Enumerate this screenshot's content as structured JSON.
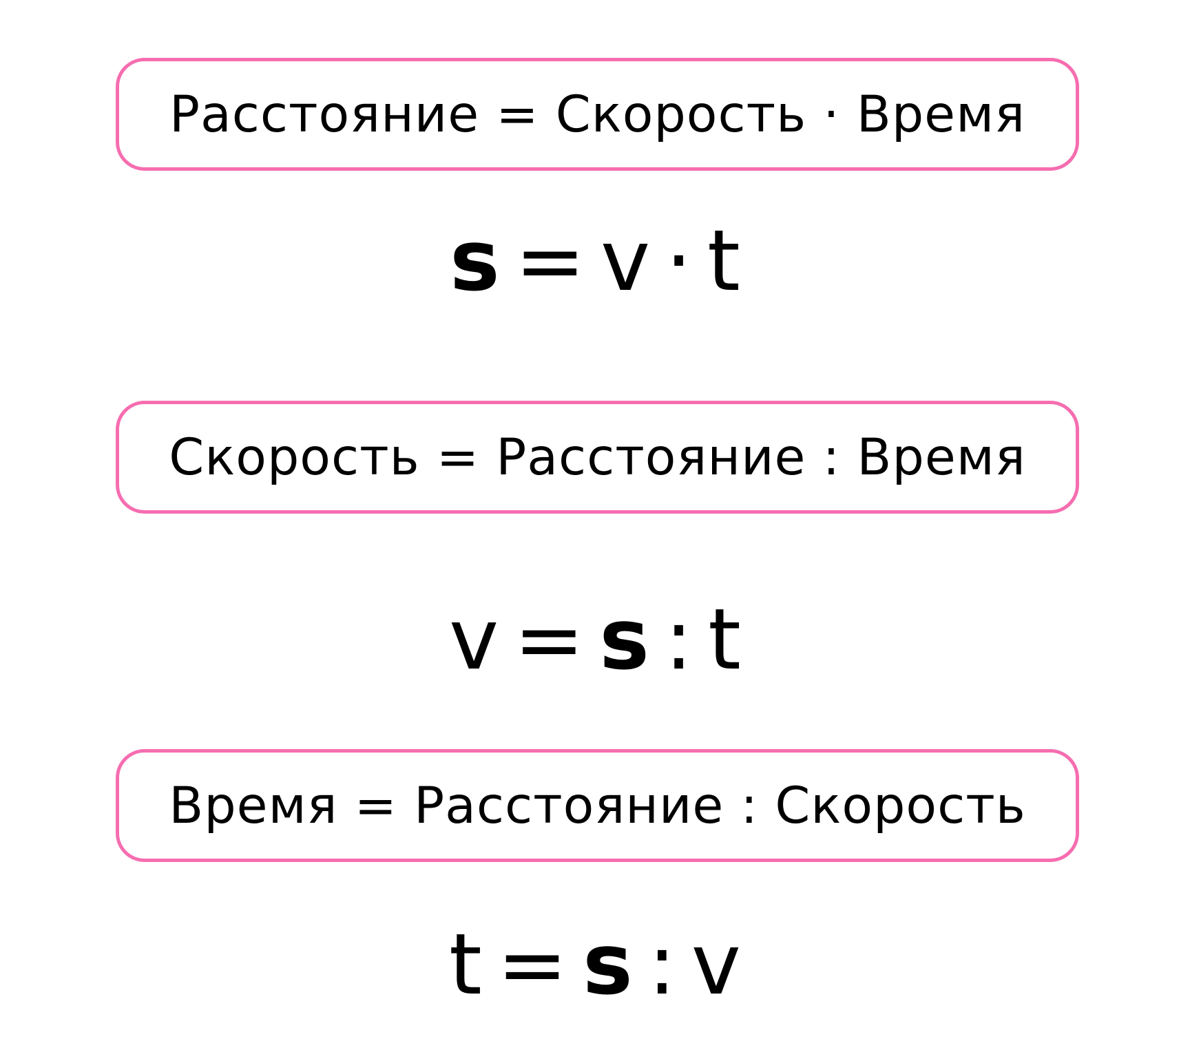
{
  "accent_color": "#f66db0",
  "rules": [
    {
      "sentence": "Расстояние = Скорость · Время",
      "formula": {
        "a": "s",
        "eq": "=",
        "b": "v",
        "op": "·",
        "c": "t"
      }
    },
    {
      "sentence": "Скорость = Расстояние : Время",
      "formula": {
        "a": "v",
        "eq": "=",
        "b": "s",
        "op": ":",
        "c": "t"
      }
    },
    {
      "sentence": "Время = Расстояние : Скорость",
      "formula": {
        "a": "t",
        "eq": "=",
        "b": "s",
        "op": ":",
        "c": "v"
      }
    }
  ]
}
